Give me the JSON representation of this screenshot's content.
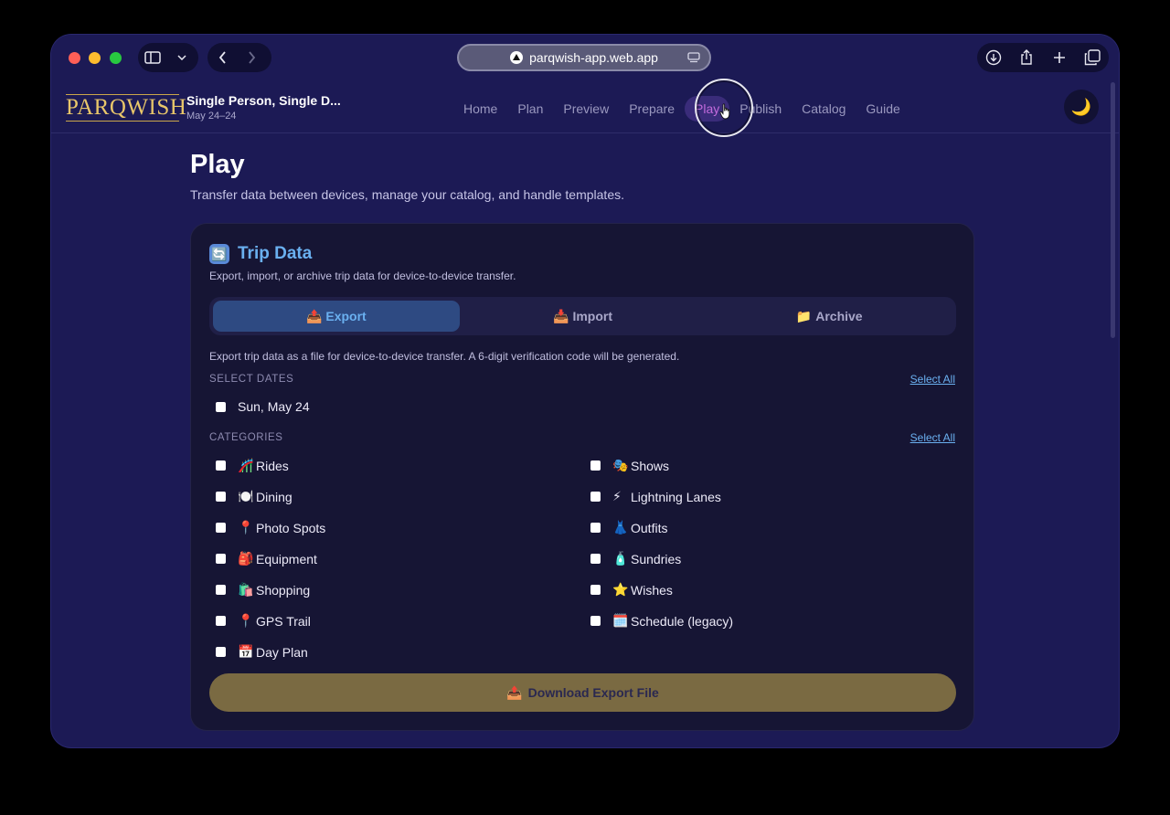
{
  "browser": {
    "url": "parqwish-app.web.app"
  },
  "header": {
    "logo_text": "PARQWISH",
    "trip_title": "Single Person, Single D...",
    "trip_dates": "May 24–24",
    "nav": [
      "Home",
      "Plan",
      "Preview",
      "Prepare",
      "Play",
      "Publish",
      "Catalog",
      "Guide"
    ],
    "active_nav": "Play",
    "theme_icon": "🌙"
  },
  "page": {
    "title": "Play",
    "subtitle": "Transfer data between devices, manage your catalog, and handle templates."
  },
  "card": {
    "icon": "🔄",
    "title": "Trip Data",
    "description": "Export, import, or archive trip data for device-to-device transfer.",
    "tabs": [
      {
        "icon": "📤",
        "label": "Export"
      },
      {
        "icon": "📥",
        "label": "Import"
      },
      {
        "icon": "📁",
        "label": "Archive"
      }
    ],
    "active_tab": "Export",
    "tab_description": "Export trip data as a file for device-to-device transfer. A 6-digit verification code will be generated.",
    "select_dates_label": "SELECT DATES",
    "select_all_label": "Select All",
    "dates": [
      "Sun, May 24"
    ],
    "categories_label": "CATEGORIES",
    "categories_left": [
      {
        "icon": "🎢",
        "label": "Rides"
      },
      {
        "icon": "🍽️",
        "label": "Dining"
      },
      {
        "icon": "📍",
        "label": "Photo Spots"
      },
      {
        "icon": "🎒",
        "label": "Equipment"
      },
      {
        "icon": "🛍️",
        "label": "Shopping"
      },
      {
        "icon": "📍",
        "label": "GPS Trail"
      },
      {
        "icon": "📅",
        "label": "Day Plan"
      }
    ],
    "categories_right": [
      {
        "icon": "🎭",
        "label": "Shows"
      },
      {
        "icon": "⚡",
        "label": "Lightning Lanes"
      },
      {
        "icon": "👗",
        "label": "Outfits"
      },
      {
        "icon": "🧴",
        "label": "Sundries"
      },
      {
        "icon": "⭐",
        "label": "Wishes"
      },
      {
        "icon": "🗓️",
        "label": "Schedule (legacy)"
      }
    ],
    "download_icon": "📤",
    "download_label": "Download Export File"
  }
}
